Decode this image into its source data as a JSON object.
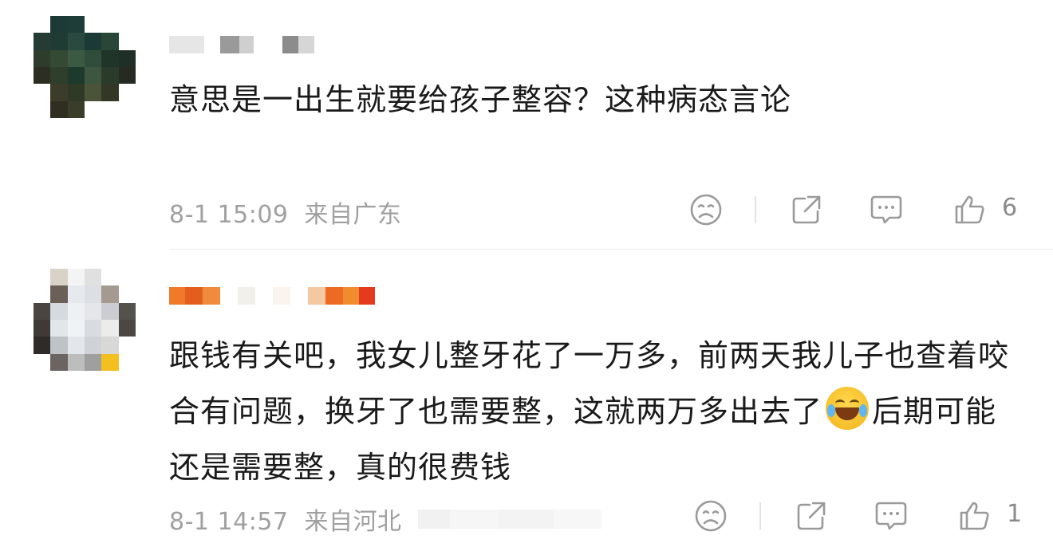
{
  "comments": [
    {
      "text": "意思是一出生就要给孩子整容？这种病态言论",
      "timestamp": "8-1 15:09",
      "location": "来自广东",
      "like_count": "6",
      "icons": [
        "dislike-icon",
        "share-icon",
        "comment-icon",
        "like-icon"
      ]
    },
    {
      "text_before_emoji": "跟钱有关吧，我女儿整牙花了一万多，前两天我儿子也查着咬合有问题，换牙了也需要整，这就两万多出去了",
      "emoji": "laugh-cry-emoji",
      "text_after_emoji": "后期可能还是需要整，真的很费钱",
      "timestamp": "8-1 14:57",
      "location": "来自河北",
      "like_count": "1",
      "icons": [
        "dislike-icon",
        "share-icon",
        "comment-icon",
        "like-icon"
      ]
    }
  ],
  "colors": {
    "text": "#1a1a1a",
    "meta": "#a0a0a0",
    "icon": "#9a9a9a",
    "divider": "#ececec"
  }
}
